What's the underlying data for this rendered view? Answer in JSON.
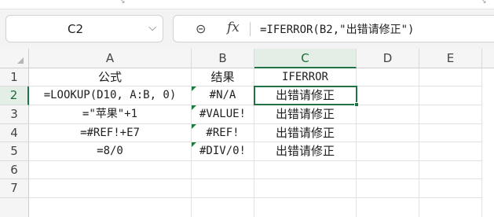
{
  "name_box": {
    "value": "C2",
    "dropdown_icon": "chevron-down-icon"
  },
  "formula_bar": {
    "zoom_icon": "zoom-icon",
    "fx_label": "fx",
    "formula": "=IFERROR(B2,\"出错请修正\")"
  },
  "columns": [
    "A",
    "B",
    "C",
    "D",
    "E"
  ],
  "rows": [
    "1",
    "2",
    "3",
    "4",
    "5",
    "6",
    "7"
  ],
  "cells": {
    "A1": "公式",
    "B1": "结果",
    "C1": "IFERROR",
    "A2": "=LOOKUP(D10, A:B, 0)",
    "B2": "#N/A",
    "C2": "出错请修正",
    "A3": "=\"苹果\"+1",
    "B3": "#VALUE!",
    "C3": "出错请修正",
    "A4": "=#REF!+E7",
    "B4": "#REF!",
    "C4": "出错请修正",
    "A5": "=8/0",
    "B5": "#DIV/0!",
    "C5": "出错请修正"
  },
  "selection": {
    "active_cell": "C2"
  },
  "colors": {
    "accent": "#217346",
    "error_marker": "#1e7b3c"
  }
}
